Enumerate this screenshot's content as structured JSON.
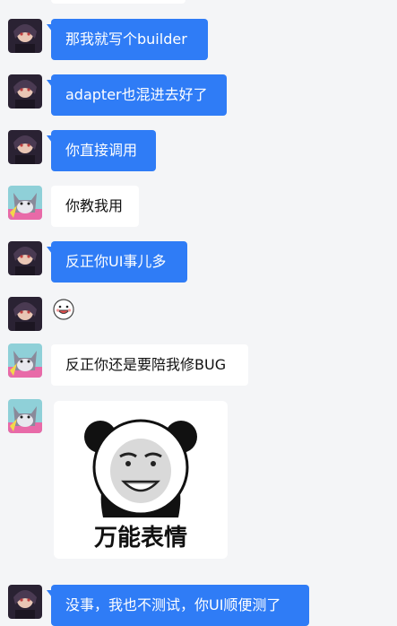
{
  "messages": [
    {
      "sender": "me",
      "type": "text",
      "text": "那我就写个builder"
    },
    {
      "sender": "me",
      "type": "text",
      "text": "adapter也混进去好了"
    },
    {
      "sender": "me",
      "type": "text",
      "text": "你直接调用"
    },
    {
      "sender": "friend",
      "type": "text",
      "text": "你教我用"
    },
    {
      "sender": "me",
      "type": "text",
      "text": "反正你UI事儿多"
    },
    {
      "sender": "me",
      "type": "emoji",
      "icon": "grinning-face-emoji"
    },
    {
      "sender": "friend",
      "type": "text",
      "text": "反正你还是要陪我修BUG"
    },
    {
      "sender": "friend",
      "type": "sticker",
      "icon": "panda-meme-sticker",
      "caption": "万能表情"
    },
    {
      "sender": "me",
      "type": "text",
      "text": "没事，我也不测试，你UI顺便测了"
    }
  ],
  "colors": {
    "background": "#f4f5f7",
    "my_bubble": "#2f7cf6",
    "friend_bubble": "#ffffff"
  }
}
